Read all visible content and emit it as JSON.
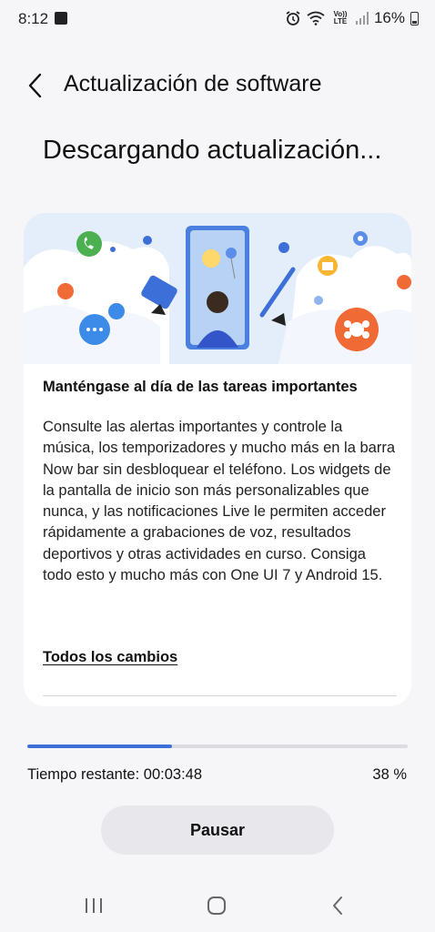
{
  "status_bar": {
    "time": "8:12",
    "network_label": "Vo)) LTE",
    "battery": "16%"
  },
  "header": {
    "back_icon": "chevron-left-icon",
    "title": "Actualización de software"
  },
  "status_heading": "Descargando actualización...",
  "card": {
    "illustration_icon": "notifications-illustration",
    "title": "Manténgase al día de las tareas importantes",
    "body": "Consulte las alertas importantes y controle la música, los temporizadores y mucho más en la barra Now bar sin desbloquear el teléfono. Los widgets de la pantalla de inicio son más personalizables que nunca, y las notificaciones Live le permiten acceder rápidamente a grabaciones de voz, resultados deportivos y otras actividades en curso. Consiga todo esto y mucho más con One UI 7 y Android 15.",
    "changes_link": "Todos los cambios"
  },
  "download": {
    "progress": 0.38,
    "time_remaining": "Tiempo restante: 00:03:48",
    "percent": "38 %",
    "pause_label": "Pausar"
  },
  "colors": {
    "accent": "#3d6fd8",
    "background": "#f6f6f8"
  }
}
